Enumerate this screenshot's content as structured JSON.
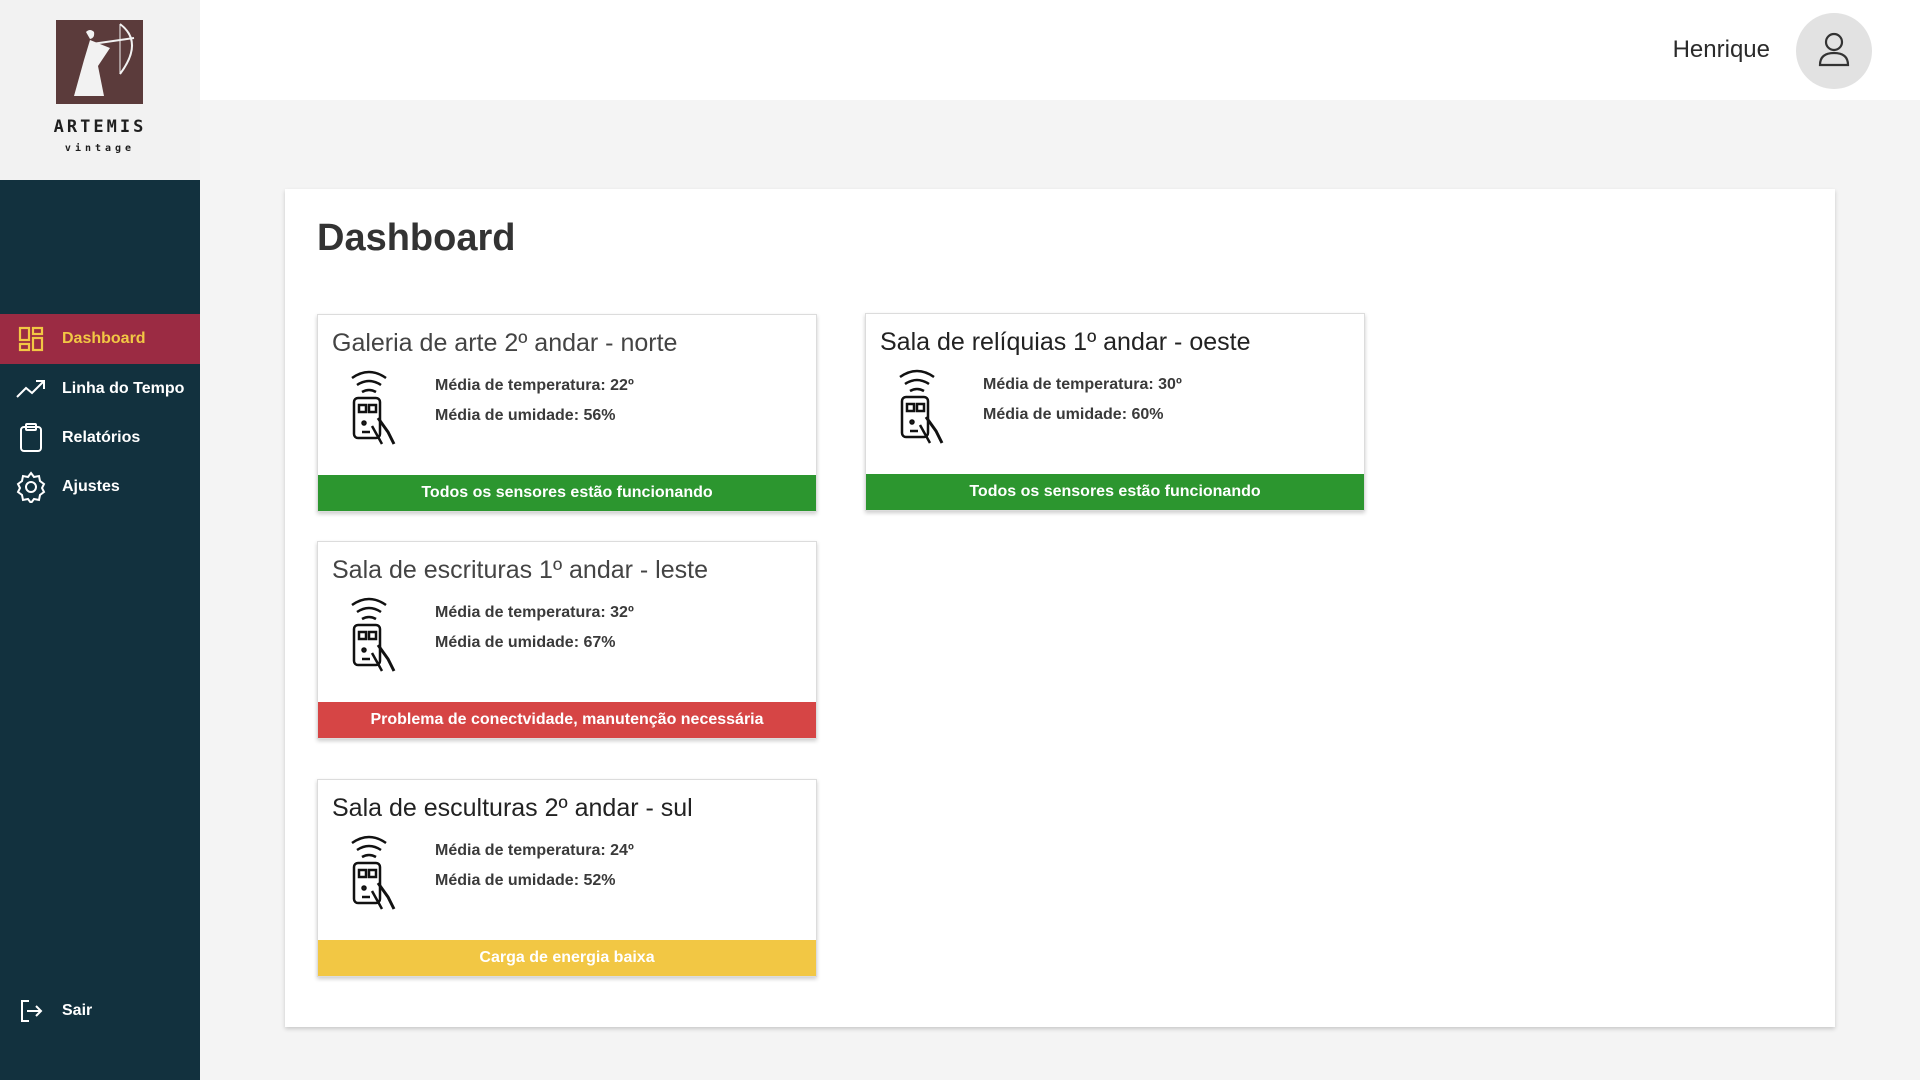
{
  "logo": {
    "title": "ARTEMIS",
    "subtitle": "vintage"
  },
  "sidebar": {
    "items": [
      {
        "label": "Dashboard",
        "icon": "dashboard-grid-icon",
        "active": true
      },
      {
        "label": "Linha do Tempo",
        "icon": "trend-line-icon",
        "active": false
      },
      {
        "label": "Relatórios",
        "icon": "clipboard-icon",
        "active": false
      },
      {
        "label": "Ajustes",
        "icon": "gear-icon",
        "active": false
      }
    ],
    "logout": {
      "label": "Sair",
      "icon": "logout-icon"
    }
  },
  "header": {
    "user_name": "Henrique",
    "avatar_icon": "user-icon"
  },
  "main": {
    "title": "Dashboard",
    "cards": [
      {
        "title": "Galeria de  arte 2º andar - norte",
        "temperature": "Média de temperatura: 22º",
        "humidity": "Média de umidade: 56%",
        "status": "Todos os sensores estão funcionando",
        "status_color": "#2c962f"
      },
      {
        "title": "Sala de relíquias  1º andar - oeste",
        "temperature": "Média de temperatura: 30º",
        "humidity": "Média de umidade: 60%",
        "status": "Todos os sensores estão funcionando",
        "status_color": "#2c962f"
      },
      {
        "title": "Sala de escrituras 1º andar - leste",
        "temperature": "Média de temperatura: 32º",
        "humidity": "Média de umidade: 67%",
        "status": "Problema de conectvidade, manutenção necessária",
        "status_color": "#d64545"
      },
      {
        "title": "Sala de esculturas 2º andar - sul",
        "temperature": "Média de temperatura: 24º",
        "humidity": "Média de umidade: 52%",
        "status": "Carga de energia baixa",
        "status_color": "#f2c744"
      }
    ]
  },
  "colors": {
    "sidebar_bg": "#12313e",
    "active_bg": "#9b2b43",
    "active_text": "#f2c744",
    "ok": "#2c962f",
    "error": "#d64545",
    "warning": "#f2c744"
  }
}
